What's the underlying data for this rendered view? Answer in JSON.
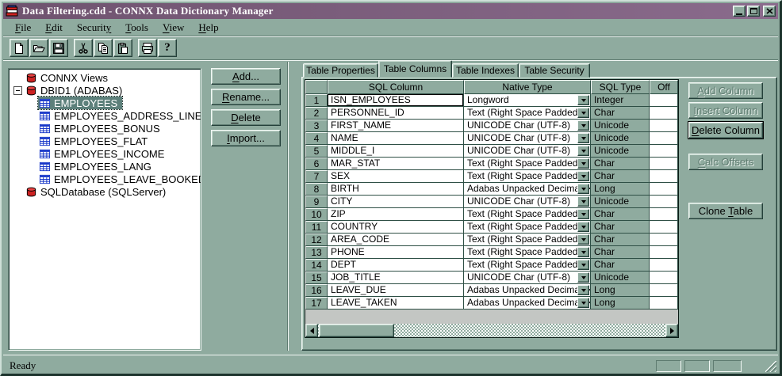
{
  "window": {
    "title": "Data Filtering.cdd - CONNX Data Dictionary Manager",
    "colors": {
      "titlebar": "#7d5f7d",
      "face": "#8fab9f",
      "selection": "#5d807b",
      "tree_table_icon": "#1636c8",
      "database_icon": "#cc2222"
    }
  },
  "menu": {
    "items": [
      {
        "pre": "",
        "key": "F",
        "post": "ile"
      },
      {
        "pre": "",
        "key": "E",
        "post": "dit"
      },
      {
        "pre": "Securit",
        "key": "y",
        "post": ""
      },
      {
        "pre": "",
        "key": "T",
        "post": "ools"
      },
      {
        "pre": "",
        "key": "V",
        "post": "iew"
      },
      {
        "pre": "",
        "key": "H",
        "post": "elp"
      }
    ]
  },
  "toolbar": {
    "buttons": [
      "new",
      "open",
      "save",
      "cut",
      "copy",
      "paste",
      "print",
      "help"
    ]
  },
  "tree": {
    "items": [
      {
        "label": "CONNX Views",
        "icon": "database",
        "level": 0
      },
      {
        "label": "DBID1 (ADABAS)",
        "icon": "database",
        "level": 0,
        "expander": "minus"
      },
      {
        "label": "EMPLOYEES",
        "icon": "table",
        "level": 1,
        "selected": true
      },
      {
        "label": "EMPLOYEES_ADDRESS_LINE",
        "icon": "table",
        "level": 1
      },
      {
        "label": "EMPLOYEES_BONUS",
        "icon": "table",
        "level": 1
      },
      {
        "label": "EMPLOYEES_FLAT",
        "icon": "table",
        "level": 1
      },
      {
        "label": "EMPLOYEES_INCOME",
        "icon": "table",
        "level": 1
      },
      {
        "label": "EMPLOYEES_LANG",
        "icon": "table",
        "level": 1
      },
      {
        "label": "EMPLOYEES_LEAVE_BOOKED",
        "icon": "table",
        "level": 1
      },
      {
        "label": "SQLDatabase (SQLServer)",
        "icon": "database",
        "level": 0
      }
    ]
  },
  "side_buttons": [
    {
      "pre": "",
      "key": "A",
      "post": "dd..."
    },
    {
      "pre": "",
      "key": "R",
      "post": "ename..."
    },
    {
      "pre": "",
      "key": "D",
      "post": "elete"
    },
    {
      "pre": "",
      "key": "I",
      "post": "mport..."
    }
  ],
  "tabs": [
    {
      "label": "Table Properties"
    },
    {
      "label": "Table Columns",
      "active": true
    },
    {
      "label": "Table Indexes"
    },
    {
      "label": "Table Security"
    }
  ],
  "grid": {
    "columns": [
      "",
      "SQL Column",
      "Native Type",
      "SQL Type",
      "Off"
    ],
    "rows": [
      {
        "num": 1,
        "sql_column": "ISN_EMPLOYEES",
        "native_type": "Longword",
        "sql_type": "Integer",
        "focused": true
      },
      {
        "num": 2,
        "sql_column": "PERSONNEL_ID",
        "native_type": "Text (Right Space Padded)",
        "sql_type": "Char"
      },
      {
        "num": 3,
        "sql_column": "FIRST_NAME",
        "native_type": "UNICODE Char (UTF-8)",
        "sql_type": "Unicode"
      },
      {
        "num": 4,
        "sql_column": "NAME",
        "native_type": "UNICODE Char (UTF-8)",
        "sql_type": "Unicode"
      },
      {
        "num": 5,
        "sql_column": "MIDDLE_I",
        "native_type": "UNICODE Char (UTF-8)",
        "sql_type": "Unicode"
      },
      {
        "num": 6,
        "sql_column": "MAR_STAT",
        "native_type": "Text (Right Space Padded)",
        "sql_type": "Char"
      },
      {
        "num": 7,
        "sql_column": "SEX",
        "native_type": "Text (Right Space Padded)",
        "sql_type": "Char"
      },
      {
        "num": 8,
        "sql_column": "BIRTH",
        "native_type": "Adabas Unpacked Decimal-> In",
        "sql_type": "Long"
      },
      {
        "num": 9,
        "sql_column": "CITY",
        "native_type": "UNICODE Char (UTF-8)",
        "sql_type": "Unicode"
      },
      {
        "num": 10,
        "sql_column": "ZIP",
        "native_type": "Text (Right Space Padded)",
        "sql_type": "Char"
      },
      {
        "num": 11,
        "sql_column": "COUNTRY",
        "native_type": "Text (Right Space Padded)",
        "sql_type": "Char"
      },
      {
        "num": 12,
        "sql_column": "AREA_CODE",
        "native_type": "Text (Right Space Padded)",
        "sql_type": "Char"
      },
      {
        "num": 13,
        "sql_column": "PHONE",
        "native_type": "Text (Right Space Padded)",
        "sql_type": "Char"
      },
      {
        "num": 14,
        "sql_column": "DEPT",
        "native_type": "Text (Right Space Padded)",
        "sql_type": "Char"
      },
      {
        "num": 15,
        "sql_column": "JOB_TITLE",
        "native_type": "UNICODE Char (UTF-8)",
        "sql_type": "Unicode"
      },
      {
        "num": 16,
        "sql_column": "LEAVE_DUE",
        "native_type": "Adabas Unpacked Decimal-> In",
        "sql_type": "Long"
      },
      {
        "num": 17,
        "sql_column": "LEAVE_TAKEN",
        "native_type": "Adabas Unpacked Decimal-> In",
        "sql_type": "Long"
      }
    ]
  },
  "column_buttons": [
    {
      "pre": "",
      "key": "A",
      "post": "dd Column",
      "disabled": true
    },
    {
      "pre": "",
      "key": "I",
      "post": "nsert Column",
      "disabled": true
    },
    {
      "pre": "",
      "key": "D",
      "post": "elete Column",
      "disabled": false,
      "default": true
    },
    {
      "pre": "",
      "key": "C",
      "post": "alc Offsets",
      "disabled": true
    },
    {
      "pre": "Clone ",
      "key": "T",
      "post": "able",
      "disabled": false
    }
  ],
  "status_bar": {
    "text": "Ready"
  }
}
